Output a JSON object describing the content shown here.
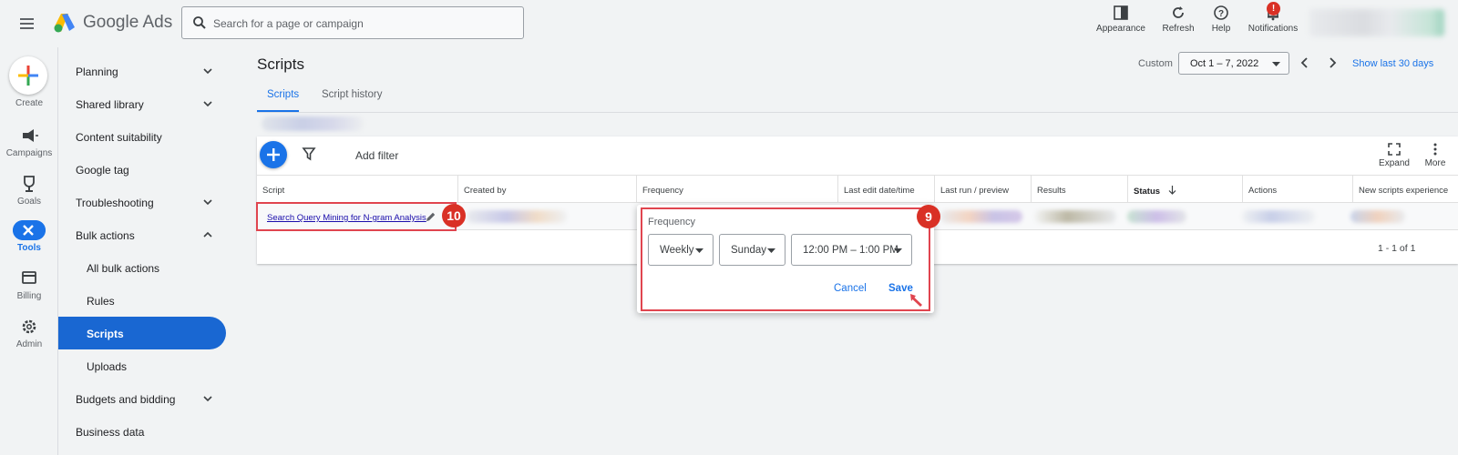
{
  "header": {
    "app_title": "Google Ads",
    "search_placeholder": "Search for a page or campaign",
    "actions": [
      {
        "label": "Appearance",
        "icon": "appearance-icon"
      },
      {
        "label": "Refresh",
        "icon": "refresh-icon"
      },
      {
        "label": "Help",
        "icon": "help-icon"
      },
      {
        "label": "Notifications",
        "icon": "bell-icon",
        "badge": "!"
      }
    ]
  },
  "rail": {
    "items": [
      {
        "label": "Create",
        "icon": "plus-icon"
      },
      {
        "label": "Campaigns",
        "icon": "megaphone-icon"
      },
      {
        "label": "Goals",
        "icon": "trophy-icon"
      },
      {
        "label": "Tools",
        "icon": "tools-icon",
        "active": true
      },
      {
        "label": "Billing",
        "icon": "card-icon"
      },
      {
        "label": "Admin",
        "icon": "gear-icon"
      }
    ]
  },
  "nav": {
    "items": [
      {
        "label": "Planning",
        "chevron": "down"
      },
      {
        "label": "Shared library",
        "chevron": "down"
      },
      {
        "label": "Content suitability"
      },
      {
        "label": "Google tag"
      },
      {
        "label": "Troubleshooting",
        "chevron": "down"
      },
      {
        "label": "Bulk actions",
        "chevron": "up"
      },
      {
        "label": "All bulk actions",
        "sub": true
      },
      {
        "label": "Rules",
        "sub": true
      },
      {
        "label": "Scripts",
        "sub": true,
        "active": true
      },
      {
        "label": "Uploads",
        "sub": true
      },
      {
        "label": "Budgets and bidding",
        "chevron": "down"
      },
      {
        "label": "Business data"
      }
    ]
  },
  "main": {
    "title": "Scripts",
    "date_label": "Custom",
    "date_range": "Oct 1 – 7, 2022",
    "show_last": "Show last 30 days",
    "tabs": [
      {
        "label": "Scripts",
        "active": true
      },
      {
        "label": "Script history"
      }
    ],
    "add_filter": "Add filter",
    "expand_label": "Expand",
    "more_label": "More"
  },
  "table": {
    "columns": [
      "Script",
      "Created by",
      "Frequency",
      "Last edit date/time",
      "Last run / preview",
      "Results",
      "Status",
      "Actions",
      "New scripts experience"
    ],
    "row": {
      "script": "Search Query Mining for N-gram Analysis"
    },
    "pagination": "1 - 1 of 1"
  },
  "popup": {
    "title": "Frequency",
    "frequency": "Weekly",
    "day": "Sunday",
    "time": "12:00 PM – 1:00 PM",
    "cancel": "Cancel",
    "save": "Save"
  },
  "annotations": {
    "script_badge": "10",
    "popup_badge": "9"
  },
  "colors": {
    "accent": "#1a73e8",
    "highlight": "#e0454f",
    "badge": "#d93025"
  }
}
